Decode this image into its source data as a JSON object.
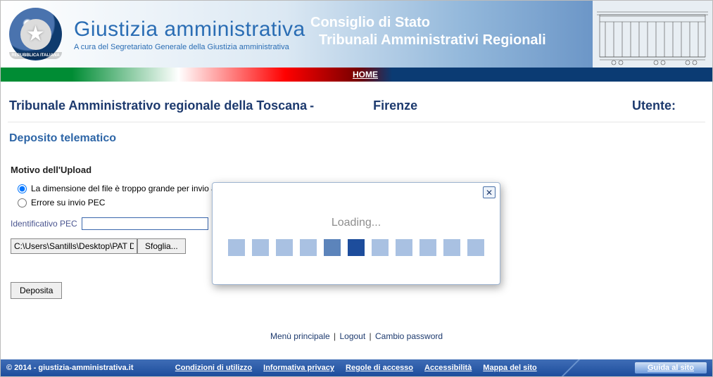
{
  "header": {
    "title": "Giustizia amministrativa",
    "subtitle": "A cura del Segretariato Generale della Giustizia amministrativa",
    "right_line1": "Consiglio di Stato",
    "right_line2": "Tribunali Amministrativi Regionali",
    "emblem_ribbon": "REPUBBLICA ITALIANA"
  },
  "nav": {
    "home": "HOME"
  },
  "court": {
    "name": "Tribunale Amministrativo regionale della Toscana ",
    "dash": "-",
    "city": "Firenze",
    "user_label": "Utente:",
    "user_value": ""
  },
  "section": {
    "title": "Deposito telematico"
  },
  "form": {
    "motivo_header": "Motivo dell'Upload",
    "radio1": "La dimensione del file è troppo grande per invio a m",
    "radio2": "Errore su invio PEC",
    "pec_label": "Identificativo PEC",
    "pec_value": "",
    "file_path": "C:\\Users\\Santills\\Desktop\\PAT Dep",
    "browse_btn": "Sfoglia...",
    "deposit_btn": "Deposita"
  },
  "links": {
    "menu": "Menù principale",
    "logout": "Logout",
    "changepw": "Cambio password"
  },
  "dialog": {
    "loading": "Loading..."
  },
  "footer": {
    "copyright": "© 2014 - giustizia-amministrativa.it",
    "cond": "Condizioni di utilizzo",
    "privacy": "Informativa privacy",
    "regole": "Regole di accesso",
    "access": "Accessibilità",
    "mappa": "Mappa del sito",
    "guide": "Guida al sito"
  }
}
